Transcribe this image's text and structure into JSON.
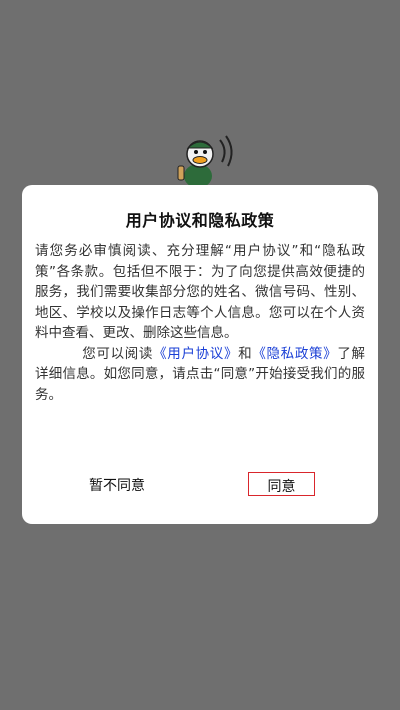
{
  "dialog": {
    "title": "用户协议和隐私政策",
    "paragraph1": "请您务必审慎阅读、充分理解“用户协议”和“隐私政策”各条款。包括但不限于：为了向您提供高效便捷的服务，我们需要收集部分您的姓名、微信号码、性别、地区、学校以及操作日志等个人信息。您可以在个人资料中查看、更改、删除这些信息。",
    "paragraph2_prefix": "您可以阅读",
    "user_agreement_link": "《用户协议》",
    "paragraph2_and": "和",
    "privacy_policy_link": "《隐私政策》",
    "paragraph2_suffix": "了解详细信息。如您同意，请点击“同意”开始接受我们的服务。",
    "decline_label": "暂不同意",
    "agree_label": "同意"
  },
  "colors": {
    "backdrop": "#6f6f6f",
    "link": "#1a3fd6",
    "agree_highlight": "#d9262c"
  },
  "icons": {
    "mascot": "cartoon-duck-mascot"
  }
}
